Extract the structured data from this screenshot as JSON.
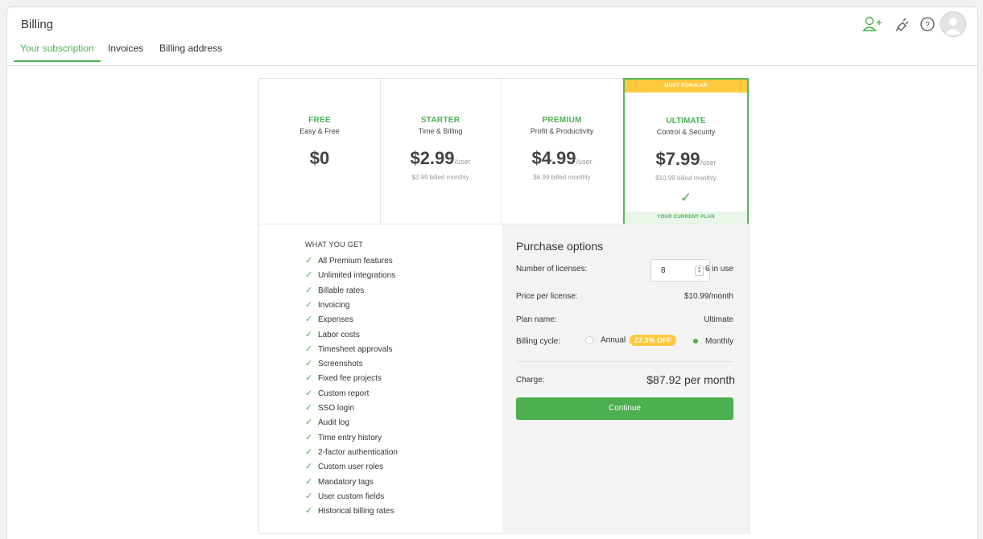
{
  "header": {
    "title": "Billing"
  },
  "tabs": [
    {
      "label": "Your subscription",
      "active": true
    },
    {
      "label": "Invoices",
      "active": false
    },
    {
      "label": "Billing address",
      "active": false
    }
  ],
  "top_icons": [
    "add-user-icon",
    "plug-icon",
    "help-icon",
    "avatar"
  ],
  "colors": {
    "accent": "#4caf50",
    "badge": "#ffc83d"
  },
  "plans": [
    {
      "name": "FREE",
      "subtitle": "Easy & Free",
      "price": "$0",
      "unit": "",
      "billed": ""
    },
    {
      "name": "STARTER",
      "subtitle": "Time & Billing",
      "price": "$2.99",
      "unit": "/user",
      "billed": "$3.99 billed monthly"
    },
    {
      "name": "PREMIUM",
      "subtitle": "Profit & Productivity",
      "price": "$4.99",
      "unit": "/user",
      "billed": "$6.99 billed monthly"
    },
    {
      "name": "ULTIMATE",
      "subtitle": "Control & Security",
      "price": "$7.99",
      "unit": "/user",
      "billed": "$10.99 billed monthly",
      "banner": "MOST POPULAR",
      "current": "YOUR CURRENT PLAN"
    }
  ],
  "features": {
    "heading": "WHAT YOU GET",
    "items": [
      "All Premium features",
      "Unlimited integrations",
      "Billable rates",
      "Invoicing",
      "Expenses",
      "Labor costs",
      "Timesheet approvals",
      "Screenshots",
      "Fixed fee projects",
      "Custom report",
      "SSO login",
      "Audit log",
      "Time entry history",
      "2-factor authentication",
      "Custom user roles",
      "Mandatory tags",
      "User custom fields",
      "Historical billing rates"
    ]
  },
  "purchase": {
    "title": "Purchase options",
    "licenses_label": "Number of licenses:",
    "licenses_value": "8",
    "in_use": "6 in use",
    "price_label": "Price per license:",
    "price_value": "$10.99/month",
    "plan_label": "Plan name:",
    "plan_value": "Ultimate",
    "cycle_label": "Billing cycle:",
    "annual_label": "Annual",
    "annual_badge": "27.3% OFF",
    "monthly_label": "Monthly",
    "selected_cycle": "Monthly",
    "charge_label": "Charge:",
    "charge_value": "$87.92 per month",
    "continue_label": "Continue"
  }
}
